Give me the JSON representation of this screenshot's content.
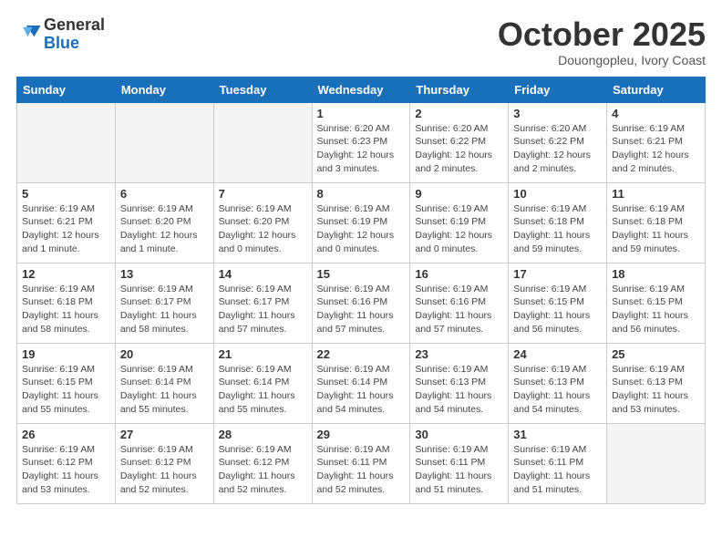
{
  "logo": {
    "general": "General",
    "blue": "Blue"
  },
  "title": "October 2025",
  "subtitle": "Douongopleu, Ivory Coast",
  "days_of_week": [
    "Sunday",
    "Monday",
    "Tuesday",
    "Wednesday",
    "Thursday",
    "Friday",
    "Saturday"
  ],
  "weeks": [
    [
      {
        "num": "",
        "info": ""
      },
      {
        "num": "",
        "info": ""
      },
      {
        "num": "",
        "info": ""
      },
      {
        "num": "1",
        "info": "Sunrise: 6:20 AM\nSunset: 6:23 PM\nDaylight: 12 hours and 3 minutes."
      },
      {
        "num": "2",
        "info": "Sunrise: 6:20 AM\nSunset: 6:22 PM\nDaylight: 12 hours and 2 minutes."
      },
      {
        "num": "3",
        "info": "Sunrise: 6:20 AM\nSunset: 6:22 PM\nDaylight: 12 hours and 2 minutes."
      },
      {
        "num": "4",
        "info": "Sunrise: 6:19 AM\nSunset: 6:21 PM\nDaylight: 12 hours and 2 minutes."
      }
    ],
    [
      {
        "num": "5",
        "info": "Sunrise: 6:19 AM\nSunset: 6:21 PM\nDaylight: 12 hours and 1 minute."
      },
      {
        "num": "6",
        "info": "Sunrise: 6:19 AM\nSunset: 6:20 PM\nDaylight: 12 hours and 1 minute."
      },
      {
        "num": "7",
        "info": "Sunrise: 6:19 AM\nSunset: 6:20 PM\nDaylight: 12 hours and 0 minutes."
      },
      {
        "num": "8",
        "info": "Sunrise: 6:19 AM\nSunset: 6:19 PM\nDaylight: 12 hours and 0 minutes."
      },
      {
        "num": "9",
        "info": "Sunrise: 6:19 AM\nSunset: 6:19 PM\nDaylight: 12 hours and 0 minutes."
      },
      {
        "num": "10",
        "info": "Sunrise: 6:19 AM\nSunset: 6:18 PM\nDaylight: 11 hours and 59 minutes."
      },
      {
        "num": "11",
        "info": "Sunrise: 6:19 AM\nSunset: 6:18 PM\nDaylight: 11 hours and 59 minutes."
      }
    ],
    [
      {
        "num": "12",
        "info": "Sunrise: 6:19 AM\nSunset: 6:18 PM\nDaylight: 11 hours and 58 minutes."
      },
      {
        "num": "13",
        "info": "Sunrise: 6:19 AM\nSunset: 6:17 PM\nDaylight: 11 hours and 58 minutes."
      },
      {
        "num": "14",
        "info": "Sunrise: 6:19 AM\nSunset: 6:17 PM\nDaylight: 11 hours and 57 minutes."
      },
      {
        "num": "15",
        "info": "Sunrise: 6:19 AM\nSunset: 6:16 PM\nDaylight: 11 hours and 57 minutes."
      },
      {
        "num": "16",
        "info": "Sunrise: 6:19 AM\nSunset: 6:16 PM\nDaylight: 11 hours and 57 minutes."
      },
      {
        "num": "17",
        "info": "Sunrise: 6:19 AM\nSunset: 6:15 PM\nDaylight: 11 hours and 56 minutes."
      },
      {
        "num": "18",
        "info": "Sunrise: 6:19 AM\nSunset: 6:15 PM\nDaylight: 11 hours and 56 minutes."
      }
    ],
    [
      {
        "num": "19",
        "info": "Sunrise: 6:19 AM\nSunset: 6:15 PM\nDaylight: 11 hours and 55 minutes."
      },
      {
        "num": "20",
        "info": "Sunrise: 6:19 AM\nSunset: 6:14 PM\nDaylight: 11 hours and 55 minutes."
      },
      {
        "num": "21",
        "info": "Sunrise: 6:19 AM\nSunset: 6:14 PM\nDaylight: 11 hours and 55 minutes."
      },
      {
        "num": "22",
        "info": "Sunrise: 6:19 AM\nSunset: 6:14 PM\nDaylight: 11 hours and 54 minutes."
      },
      {
        "num": "23",
        "info": "Sunrise: 6:19 AM\nSunset: 6:13 PM\nDaylight: 11 hours and 54 minutes."
      },
      {
        "num": "24",
        "info": "Sunrise: 6:19 AM\nSunset: 6:13 PM\nDaylight: 11 hours and 54 minutes."
      },
      {
        "num": "25",
        "info": "Sunrise: 6:19 AM\nSunset: 6:13 PM\nDaylight: 11 hours and 53 minutes."
      }
    ],
    [
      {
        "num": "26",
        "info": "Sunrise: 6:19 AM\nSunset: 6:12 PM\nDaylight: 11 hours and 53 minutes."
      },
      {
        "num": "27",
        "info": "Sunrise: 6:19 AM\nSunset: 6:12 PM\nDaylight: 11 hours and 52 minutes."
      },
      {
        "num": "28",
        "info": "Sunrise: 6:19 AM\nSunset: 6:12 PM\nDaylight: 11 hours and 52 minutes."
      },
      {
        "num": "29",
        "info": "Sunrise: 6:19 AM\nSunset: 6:11 PM\nDaylight: 11 hours and 52 minutes."
      },
      {
        "num": "30",
        "info": "Sunrise: 6:19 AM\nSunset: 6:11 PM\nDaylight: 11 hours and 51 minutes."
      },
      {
        "num": "31",
        "info": "Sunrise: 6:19 AM\nSunset: 6:11 PM\nDaylight: 11 hours and 51 minutes."
      },
      {
        "num": "",
        "info": ""
      }
    ]
  ]
}
